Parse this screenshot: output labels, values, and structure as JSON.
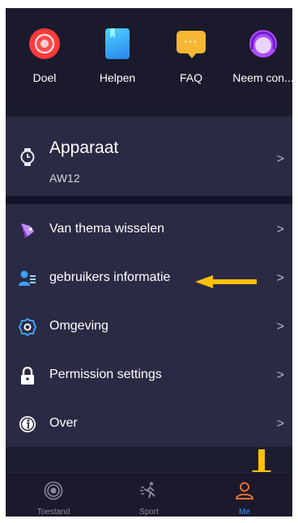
{
  "quick_actions": [
    {
      "label": "Doel",
      "icon": "target-icon"
    },
    {
      "label": "Helpen",
      "icon": "book-icon"
    },
    {
      "label": "FAQ",
      "icon": "faq-chat-icon"
    },
    {
      "label": "Neem con...",
      "icon": "support-headset-icon"
    }
  ],
  "device": {
    "title": "Apparaat",
    "model": "AW12",
    "icon": "watch-icon"
  },
  "menu": [
    {
      "label": "Van thema wisselen",
      "icon": "theme-icon"
    },
    {
      "label": "gebruikers informatie",
      "icon": "user-info-icon"
    },
    {
      "label": "Omgeving",
      "icon": "settings-gear-icon"
    },
    {
      "label": "Permission settings",
      "icon": "lock-icon"
    },
    {
      "label": "Over",
      "icon": "info-icon"
    }
  ],
  "chevron": ">",
  "tabs": [
    {
      "label": "Toestand",
      "icon": "status-icon",
      "active": false
    },
    {
      "label": "Sport",
      "icon": "running-icon",
      "active": false
    },
    {
      "label": "Me",
      "icon": "profile-icon",
      "active": true
    }
  ],
  "colors": {
    "background": "#1c1c30",
    "card": "#2a2a44",
    "active_tab": "#3a8bff",
    "annotation_arrow": "#ffc107"
  }
}
